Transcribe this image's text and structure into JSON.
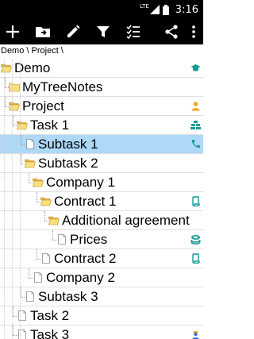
{
  "status_bar": {
    "time": "3:16",
    "network": "LTE"
  },
  "toolbar": {
    "items": [
      "add",
      "folder-move",
      "edit",
      "filter",
      "checklist",
      "share",
      "more"
    ]
  },
  "breadcrumb": "Demo \\ Project \\",
  "tree": [
    {
      "label": "Demo",
      "depth": 0,
      "type": "folder-open",
      "right_icon": "graduation-cap-icon",
      "right_color": "#169b93"
    },
    {
      "label": "MyTreeNotes",
      "depth": 1,
      "type": "folder",
      "right_icon": null
    },
    {
      "label": "Project",
      "depth": 1,
      "type": "folder-open",
      "right_icon": "person-icon",
      "right_color": "#f5a623"
    },
    {
      "label": "Task 1",
      "depth": 2,
      "type": "folder-open",
      "right_icon": "bricks-icon",
      "right_color": "#169b93"
    },
    {
      "label": "Subtask 1",
      "depth": 3,
      "type": "note",
      "right_icon": "phone-icon",
      "right_color": "#169b93",
      "selected": true
    },
    {
      "label": "Subtask 2",
      "depth": 3,
      "type": "folder-open",
      "right_icon": null
    },
    {
      "label": "Company 1",
      "depth": 4,
      "type": "folder-open",
      "right_icon": null
    },
    {
      "label": "Contract 1",
      "depth": 5,
      "type": "folder-open",
      "right_icon": "contract-icon",
      "right_color": "#169b93"
    },
    {
      "label": "Additional agreement",
      "depth": 6,
      "type": "folder-open",
      "right_icon": null
    },
    {
      "label": "Prices",
      "depth": 7,
      "type": "note",
      "right_icon": "money-icon",
      "right_color": "#169b93"
    },
    {
      "label": "Contract 2",
      "depth": 5,
      "type": "note",
      "right_icon": "contract-icon",
      "right_color": "#169b93"
    },
    {
      "label": "Company 2",
      "depth": 4,
      "type": "note",
      "right_icon": null
    },
    {
      "label": "Subtask 3",
      "depth": 3,
      "type": "note",
      "right_icon": null
    },
    {
      "label": "Task 2",
      "depth": 2,
      "type": "note",
      "right_icon": null
    },
    {
      "label": "Task 3",
      "depth": 2,
      "type": "note",
      "right_icon": "worker-icon",
      "right_color": "#2a6fdb"
    }
  ]
}
